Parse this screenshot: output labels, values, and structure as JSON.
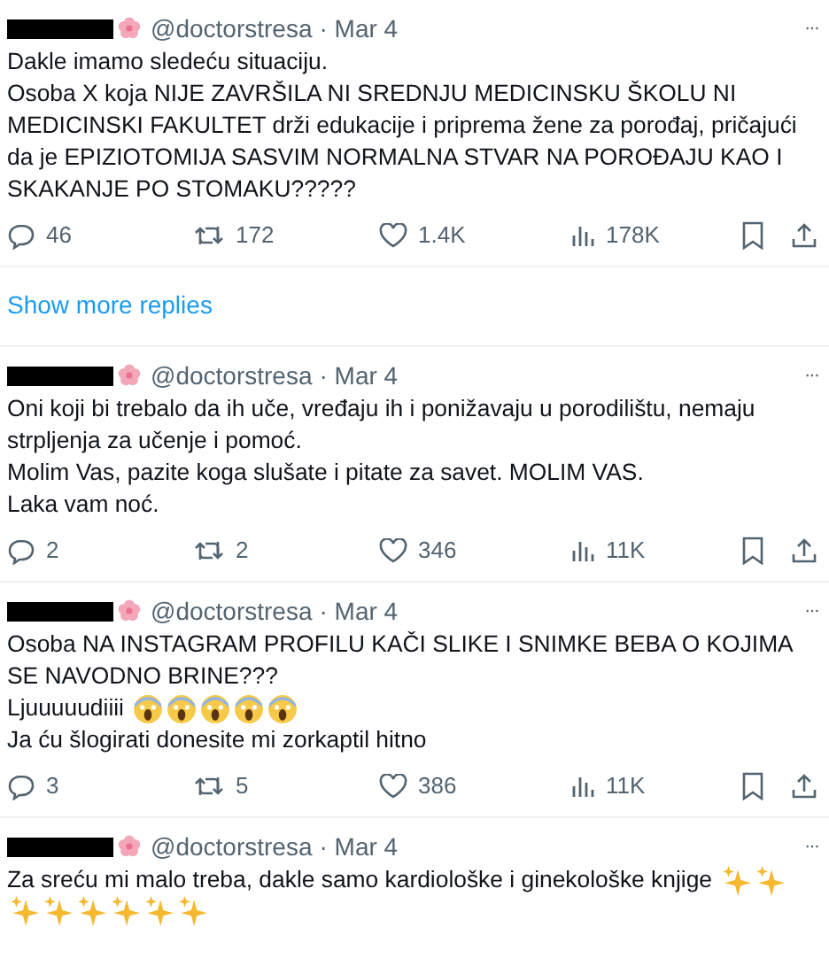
{
  "tweets": [
    {
      "handle": "@doctorstresa",
      "date": "· Mar 4",
      "more": "···",
      "paragraphs": [
        [
          {
            "kind": "text",
            "text": "Dakle imamo sledeću situaciju."
          }
        ],
        [
          {
            "kind": "text",
            "text": "Osoba X koja NIJE ZAVRŠILA NI SREDNJU MEDICINSKU ŠKOLU NI MEDICINSKI FAKULTET drži edukacije i priprema žene za porođaj, pričajući da je EPIZIOTOMIJA SASVIM NORMALNA STVAR NA POROĐAJU KAO I SKAKANJE PO STOMAKU?????"
          }
        ]
      ],
      "stats": {
        "replies": "46",
        "reposts": "172",
        "likes": "1.4K",
        "views": "178K"
      }
    },
    {
      "kind": "show_more",
      "text": "Show more replies"
    },
    {
      "handle": "@doctorstresa",
      "date": "· Mar 4",
      "more": "···",
      "paragraphs": [
        [
          {
            "kind": "text",
            "text": "Oni koji bi trebalo da ih uče, vređaju ih i ponižavaju u porodilištu, nemaju strpljenja za učenje i pomoć."
          }
        ],
        [
          {
            "kind": "text",
            "text": "Molim Vas, pazite koga slušate i pitate za savet. MOLIM VAS."
          }
        ],
        [
          {
            "kind": "text",
            "text": "Laka vam noć."
          }
        ]
      ],
      "stats": {
        "replies": "2",
        "reposts": "2",
        "likes": "346",
        "views": "11K"
      }
    },
    {
      "handle": "@doctorstresa",
      "date": "· Mar 4",
      "more": "···",
      "paragraphs": [
        [
          {
            "kind": "text",
            "text": "Osoba NA INSTAGRAM PROFILU KAČI SLIKE I SNIMKE BEBA O KOJIMA SE NAVODNO BRINE???"
          }
        ],
        [
          {
            "kind": "text",
            "text": "Ljuuuuudiiii"
          },
          {
            "kind": "scream"
          },
          {
            "kind": "scream"
          },
          {
            "kind": "scream"
          },
          {
            "kind": "scream"
          },
          {
            "kind": "scream"
          }
        ],
        [
          {
            "kind": "text",
            "text": "Ja ću šlogirati donesite mi zorkaptil hitno"
          }
        ]
      ],
      "stats": {
        "replies": "3",
        "reposts": "5",
        "likes": "386",
        "views": "11K"
      }
    },
    {
      "handle": "@doctorstresa",
      "date": "· Mar 4",
      "more": "···",
      "paragraphs": [
        [
          {
            "kind": "text",
            "text": "Za sreću mi malo treba, dakle samo kardiološke i ginekološke knjige"
          },
          {
            "kind": "sparkles"
          },
          {
            "kind": "sparkles"
          },
          {
            "kind": "sparkles"
          },
          {
            "kind": "sparkles"
          },
          {
            "kind": "sparkles"
          },
          {
            "kind": "sparkles"
          },
          {
            "kind": "sparkles"
          },
          {
            "kind": "sparkles"
          }
        ]
      ]
    }
  ]
}
